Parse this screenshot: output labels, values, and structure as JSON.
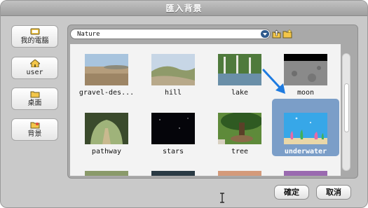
{
  "dialog": {
    "title": "匯入背景"
  },
  "sidebar": {
    "items": [
      {
        "label": "我的電腦",
        "icon": "computer-icon"
      },
      {
        "label": "user",
        "icon": "home-icon"
      },
      {
        "label": "桌面",
        "icon": "folder-icon"
      },
      {
        "label": "背景",
        "icon": "background-folder-icon"
      }
    ]
  },
  "browser": {
    "path_label": "Nature",
    "up_icon": "up-folder-icon",
    "new_folder_icon": "new-folder-icon",
    "items": [
      {
        "label": "gravel-des..."
      },
      {
        "label": "hill"
      },
      {
        "label": "lake"
      },
      {
        "label": "moon"
      },
      {
        "label": "pathway"
      },
      {
        "label": "stars"
      },
      {
        "label": "tree"
      },
      {
        "label": "underwater",
        "selected": true
      }
    ],
    "scroll_position": 0.35
  },
  "buttons": {
    "ok": "確定",
    "cancel": "取消"
  },
  "colors": {
    "selection": "#7b9ec8",
    "title_bar": "#a9a9a9",
    "arrow": "#1e7be0"
  }
}
